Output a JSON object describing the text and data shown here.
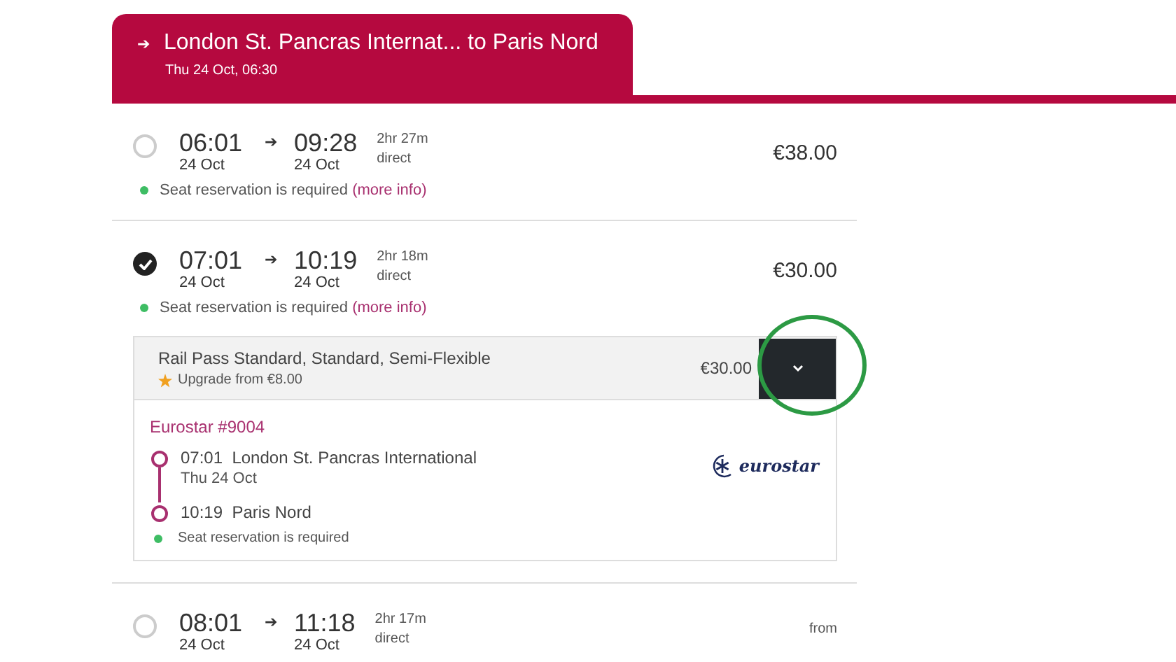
{
  "header": {
    "arrow": "➔",
    "title": "London St. Pancras Internat... to Paris Nord",
    "date": "Thu 24 Oct, 06:30"
  },
  "journeys": [
    {
      "selected": false,
      "depart_time": "06:01",
      "depart_date": "24 Oct",
      "arrow": "➔",
      "arrive_time": "09:28",
      "arrive_date": "24 Oct",
      "duration": "2hr 27m",
      "stops": "direct",
      "price": "€38.00",
      "note": "Seat reservation is required",
      "note_link": "(more info)"
    },
    {
      "selected": true,
      "depart_time": "07:01",
      "depart_date": "24 Oct",
      "arrow": "➔",
      "arrive_time": "10:19",
      "arrive_date": "24 Oct",
      "duration": "2hr 18m",
      "stops": "direct",
      "price": "€30.00",
      "note": "Seat reservation is required",
      "note_link": "(more info)",
      "fare": {
        "name": "Rail Pass Standard, Standard, Semi-Flexible",
        "upgrade": "Upgrade from €8.00",
        "price": "€30.00",
        "train": "Eurostar #9004",
        "operator_logo": "eurostar",
        "stops": [
          {
            "time": "07:01",
            "station": "London St. Pancras International",
            "date": "Thu 24 Oct"
          },
          {
            "time": "10:19",
            "station": "Paris Nord"
          }
        ],
        "note": "Seat reservation is required"
      }
    },
    {
      "selected": false,
      "depart_time": "08:01",
      "depart_date": "24 Oct",
      "arrow": "➔",
      "arrive_time": "11:18",
      "arrive_date": "24 Oct",
      "duration": "2hr 17m",
      "stops": "direct",
      "price_prefix": "from"
    }
  ]
}
